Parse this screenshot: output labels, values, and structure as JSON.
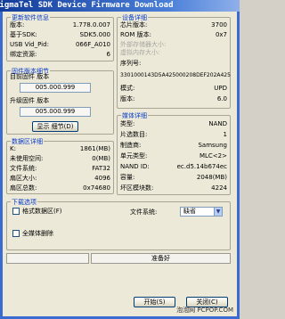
{
  "window": {
    "title": "SigmaTel SDK Device Firmware Download"
  },
  "update_info": {
    "title": "更新软件信息",
    "rows": [
      {
        "k": "版本:",
        "v": "1.778.0.007"
      },
      {
        "k": "基于SDK:",
        "v": "SDK5.000"
      },
      {
        "k": "USB Vid_Pid:",
        "v": "066F_A010"
      },
      {
        "k": "绑定资源:",
        "v": "6"
      }
    ]
  },
  "firmware_version": {
    "title": "固件版本细节",
    "current_label": "目前固件 版本",
    "current_value": "005.000.999",
    "upgrade_label": "升级固件 版本",
    "upgrade_value": "005.000.999",
    "details_button": "显示 细节(D)"
  },
  "data_area": {
    "title": "数据区详细",
    "rows": [
      {
        "k": "K:",
        "v": "1861(MB)"
      },
      {
        "k": "未使用空间:",
        "v": "0(MB)"
      },
      {
        "k": "文件系统:",
        "v": "FAT32"
      },
      {
        "k": "扇区大小:",
        "v": "4096"
      },
      {
        "k": "扇区总数:",
        "v": "0x74680"
      }
    ]
  },
  "device_info": {
    "title": "设备详细",
    "rows_top": [
      {
        "k": "芯片版本:",
        "v": "3700",
        "disabled": false
      },
      {
        "k": "ROM 版本:",
        "v": "0x7",
        "disabled": false
      },
      {
        "k": "外部存储器大小:",
        "v": "",
        "disabled": true
      },
      {
        "k": "虚拟内存大小:",
        "v": "",
        "disabled": true
      }
    ],
    "serial_label": "序列号:",
    "serial_value": "3301000143D5A425000208DEF202A425",
    "rows_bottom": [
      {
        "k": "模式:",
        "v": "UPD"
      },
      {
        "k": "版本:",
        "v": "6.0"
      }
    ]
  },
  "media_info": {
    "title": "媒体详细",
    "rows": [
      {
        "k": "类型:",
        "v": "NAND"
      },
      {
        "k": "片选数目:",
        "v": "1"
      },
      {
        "k": "制造商:",
        "v": "Samsung"
      },
      {
        "k": "单元类型:",
        "v": "MLC<2>"
      },
      {
        "k": "NAND ID:",
        "v": "ec.d5.14b674ec"
      },
      {
        "k": "容量:",
        "v": "2048(MB)"
      },
      {
        "k": "坏区模块数:",
        "v": "4224"
      }
    ]
  },
  "download_options": {
    "title": "下载选项",
    "format_label": "格式数据区(F)",
    "fs_label": "文件系统:",
    "fs_value": "缺省",
    "erase_label": "全媒体删除"
  },
  "status": {
    "text": "准备好",
    "progress_left": 0,
    "progress_right": 0
  },
  "buttons": {
    "start": "开始(S)",
    "close": "关闭(C)"
  },
  "watermark": "泡泡网 PCPOP.COM",
  "icons": {
    "dropdown": "chevron-down-icon"
  }
}
